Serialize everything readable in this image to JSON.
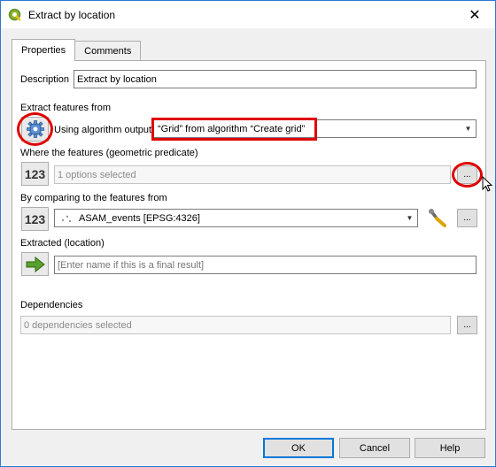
{
  "window": {
    "title": "Extract by location",
    "close_label": "✕"
  },
  "tabs": [
    {
      "label": "Properties"
    },
    {
      "label": "Comments"
    }
  ],
  "description": {
    "label": "Description",
    "value": "Extract by location"
  },
  "extract_from": {
    "label": "Extract features from",
    "source_label": "Using algorithm output",
    "value": "“Grid” from algorithm “Create grid”"
  },
  "predicate": {
    "label": "Where the features (geometric predicate)",
    "icon_text": "123",
    "value": "1 options selected",
    "button_label": "..."
  },
  "compare": {
    "label": "By comparing to the features from",
    "icon_text": "123",
    "value": "ASAM_events [EPSG:4326]",
    "button_label": "..."
  },
  "extracted": {
    "label": "Extracted (location)",
    "placeholder": "[Enter name if this is a final result]"
  },
  "dependencies": {
    "label": "Dependencies",
    "value": "0 dependencies selected",
    "button_label": "..."
  },
  "buttons": {
    "ok": "OK",
    "cancel": "Cancel",
    "help": "Help"
  },
  "colors": {
    "highlight": "#e00000",
    "accent": "#0078d7",
    "qgis_green": "#589632"
  }
}
